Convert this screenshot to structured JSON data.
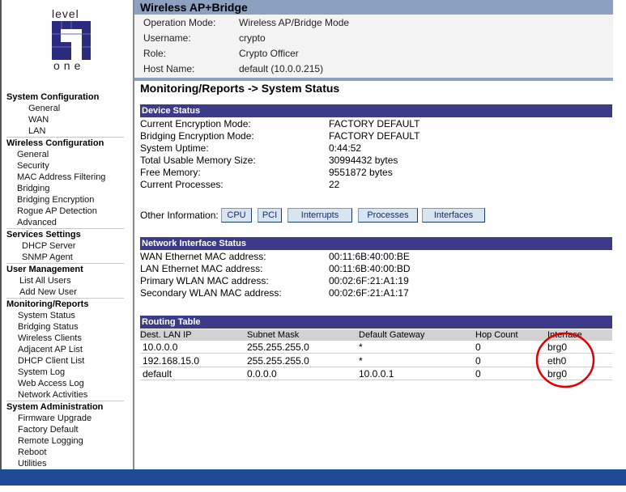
{
  "logo": {
    "text_top": "level",
    "text_bottom": "one"
  },
  "sidebar": [
    {
      "title": "System Configuration",
      "indent": 27,
      "items": [
        "General",
        "WAN",
        "LAN"
      ]
    },
    {
      "title": "Wireless Configuration",
      "indent": 13,
      "items": [
        "General",
        "Security",
        "MAC Address Filtering",
        "Bridging",
        "Bridging Encryption",
        "Rogue AP Detection",
        "Advanced"
      ]
    },
    {
      "title": "Services Settings",
      "indent": 19,
      "items": [
        "DHCP Server",
        "SNMP Agent"
      ]
    },
    {
      "title": "User Management",
      "indent": 16,
      "items": [
        "List All Users",
        "Add New User"
      ]
    },
    {
      "title": "Monitoring/Reports",
      "indent": 14,
      "items": [
        "System Status",
        "Bridging Status",
        "Wireless Clients",
        "Adjacent AP List",
        "DHCP Client List",
        "System Log",
        "Web Access Log",
        "Network Activities"
      ]
    },
    {
      "title": "System Administration",
      "indent": 14,
      "items": [
        "Firmware Upgrade",
        "Factory Default",
        "Remote Logging",
        "Reboot",
        "Utilities"
      ]
    }
  ],
  "header": {
    "title": "Wireless AP+Bridge",
    "rows": [
      {
        "label": "Operation Mode:",
        "value": "Wireless AP/Bridge Mode"
      },
      {
        "label": "Username:",
        "value": "crypto"
      },
      {
        "label": "Role:",
        "value": "Crypto Officer"
      },
      {
        "label": "Host Name:",
        "value": "default (10.0.0.215)"
      }
    ]
  },
  "page_title": "Monitoring/Reports -> System Status",
  "device_status": {
    "title": "Device Status",
    "rows": [
      {
        "label": "Current Encryption Mode:",
        "value": "FACTORY DEFAULT"
      },
      {
        "label": "Bridging Encryption Mode:",
        "value": "FACTORY DEFAULT"
      },
      {
        "label": "System Uptime:",
        "value": "0:44:52"
      },
      {
        "label": "Total Usable Memory Size:",
        "value": "30994432 bytes"
      },
      {
        "label": "Free Memory:",
        "value": "9551872 bytes"
      },
      {
        "label": "Current Processes:",
        "value": "22"
      }
    ]
  },
  "other_info": {
    "label": "Other Information:",
    "buttons": [
      "CPU",
      "PCI",
      "Interrupts",
      "Processes",
      "Interfaces"
    ]
  },
  "network_status": {
    "title": "Network Interface Status",
    "rows": [
      {
        "label": "WAN Ethernet MAC address:",
        "value": "00:11:6B:40:00:BE"
      },
      {
        "label": "LAN Ethernet MAC address:",
        "value": "00:11:6B:40:00:BD"
      },
      {
        "label": "Primary WLAN MAC address:",
        "value": "00:02:6F:21:A1:19"
      },
      {
        "label": "Secondary WLAN MAC address:",
        "value": "00:02:6F:21:A1:17"
      }
    ]
  },
  "routing_table": {
    "title": "Routing Table",
    "columns": [
      "Dest. LAN IP",
      "Subnet Mask",
      "Default Gateway",
      "Hop Count",
      "Interface"
    ],
    "rows": [
      [
        "10.0.0.0",
        "255.255.255.0",
        "*",
        "0",
        "brg0"
      ],
      [
        "192.168.15.0",
        "255.255.255.0",
        "*",
        "0",
        "eth0"
      ],
      [
        "default",
        "0.0.0.0",
        "10.0.0.1",
        "0",
        "brg0"
      ]
    ]
  },
  "colors": {
    "section_header": "#3b3b8a",
    "top_band": "#8ca0c0",
    "footer": "#1f4b96",
    "annotation": "#e00000"
  }
}
